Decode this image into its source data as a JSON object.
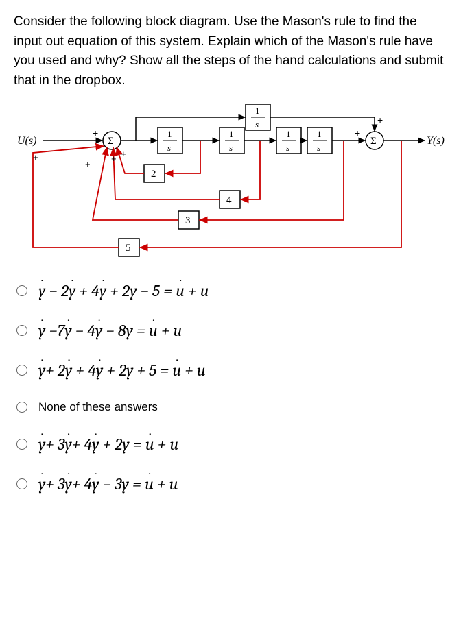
{
  "question": "Consider the following block diagram. Use the Mason's rule to find the input out equation of this system. Explain which of the Mason's rule have you used and why? Show all the steps of the hand calculations and submit that in the dropbox.",
  "diagram": {
    "input": "U(s)",
    "output": "Y(s)",
    "sum_symbol": "Σ",
    "blocks": {
      "b1": "1",
      "b1d": "s",
      "b2": "1",
      "b2d": "s",
      "b3": "1",
      "b3d": "s",
      "b4": "1",
      "b4d": "s",
      "btop": "1",
      "btopd": "s",
      "fb2": "2",
      "fb3": "3",
      "fb4": "4",
      "fb5": "5"
    },
    "signs": {
      "p": "+"
    }
  },
  "options": [
    {
      "eq": {
        "l4y": "y",
        "l3y": " − 2",
        "y3": "y",
        "l2y": " + 4",
        "y2": "y",
        "tail": " + 2y − 5 = ",
        "u3": "u",
        "rtail": " + u"
      }
    },
    {
      "eq": {
        "l4y": "y",
        "l3y": " −7",
        "y3": "y",
        "l2y": " − 4",
        "y2": "y",
        "tail": " − 8y = ",
        "u3": "u",
        "rtail": " + u"
      }
    },
    {
      "eq": {
        "l4y": "y",
        "l3y": "+ 2",
        "y3": "y",
        "l2y": " + 4",
        "y2": "y",
        "tail": " + 2y + 5 = ",
        "u3": "u",
        "rtail": " + u"
      }
    },
    {
      "text": "None of these answers"
    },
    {
      "eq": {
        "l4y": "y",
        "l3y": "+ 3",
        "y3": "y",
        "l2y": "+ 4",
        "y2": "y",
        "tail": " + 2y = ",
        "u3": "u",
        "rtail": " + u"
      }
    },
    {
      "eq": {
        "l4y": "y",
        "l3y": "+ 3",
        "y3": "y",
        "l2y": "+ 4",
        "y2": "y",
        "tail": " − 3y = ",
        "u3": "u",
        "rtail": " + u"
      }
    }
  ]
}
